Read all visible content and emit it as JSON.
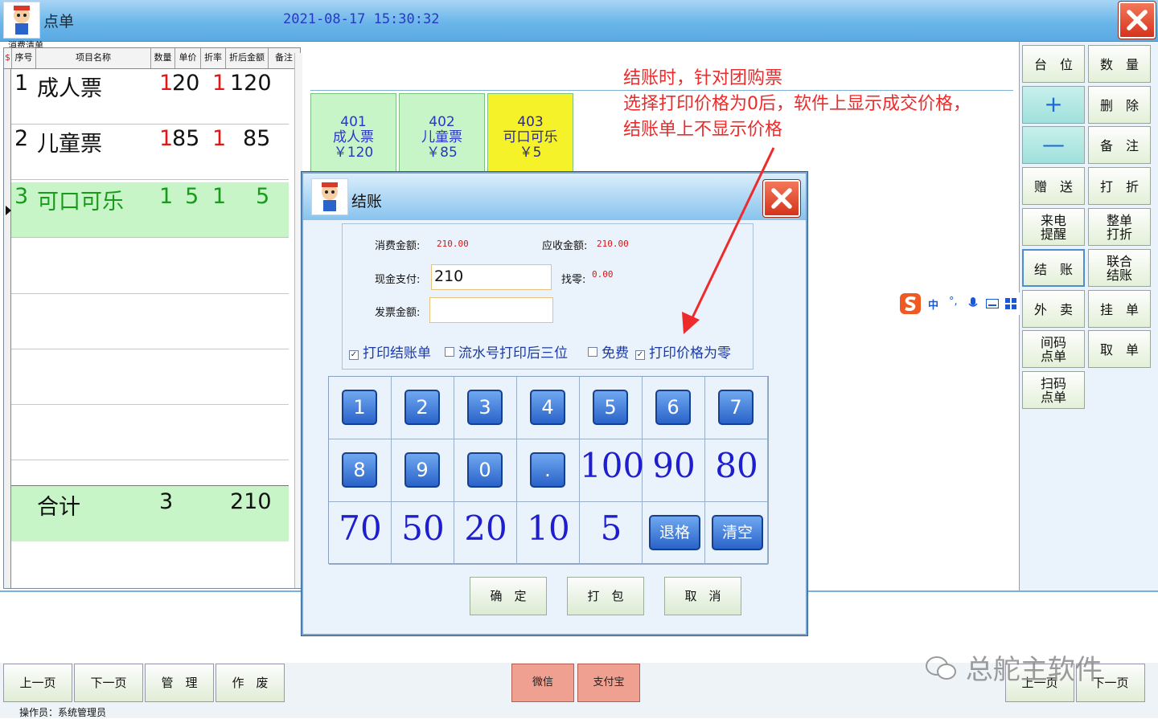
{
  "window": {
    "title": "点单",
    "datetime": "2021-08-17  15:30:32"
  },
  "order": {
    "caption": "消费清单",
    "columns": [
      "序号",
      "项目名称",
      "数量",
      "单价",
      "折率",
      "折后金额",
      "备注"
    ],
    "rows": [
      {
        "no": "1",
        "name": "成人票",
        "qty": "1",
        "price": "20",
        "rate": "1",
        "amount": "120"
      },
      {
        "no": "2",
        "name": "儿童票",
        "qty": "1",
        "price": "85",
        "rate": "1",
        "amount": "85"
      },
      {
        "no": "3",
        "name": "可口可乐",
        "qty": "1",
        "price": "5",
        "rate": "1",
        "amount": "5"
      }
    ],
    "total": {
      "label": "合计",
      "qty": "3",
      "amount": "210"
    }
  },
  "products": [
    {
      "code": "401",
      "name": "成人票",
      "price": "￥120"
    },
    {
      "code": "402",
      "name": "儿童票",
      "price": "￥85"
    },
    {
      "code": "403",
      "name": "可口可乐",
      "price": "￥5"
    }
  ],
  "annotation": [
    "结账时，针对团购票",
    "选择打印价格为0后，软件上显示成交价格，",
    "结账单上不显示价格"
  ],
  "right_buttons": [
    {
      "line1": "台　位",
      "line2": ""
    },
    {
      "line1": "数　量",
      "line2": ""
    },
    {
      "line1": "+",
      "line2": ""
    },
    {
      "line1": "删　除",
      "line2": ""
    },
    {
      "line1": "—",
      "line2": ""
    },
    {
      "line1": "备　注",
      "line2": ""
    },
    {
      "line1": "赠　送",
      "line2": ""
    },
    {
      "line1": "打　折",
      "line2": ""
    },
    {
      "line1": "来电",
      "line2": "提醒"
    },
    {
      "line1": "整单",
      "line2": "打折"
    },
    {
      "line1": "结　账",
      "line2": ""
    },
    {
      "line1": "联合",
      "line2": "结账"
    },
    {
      "line1": "外　卖",
      "line2": ""
    },
    {
      "line1": "挂　单",
      "line2": ""
    },
    {
      "line1": "间码",
      "line2": "点单"
    },
    {
      "line1": "取　单",
      "line2": ""
    },
    {
      "line1": "扫码",
      "line2": "点单"
    }
  ],
  "ime": {
    "label": "中"
  },
  "footer": {
    "prev": "上一页",
    "next": "下一页",
    "manage": "管　理",
    "void": "作　废",
    "wechat": "微信",
    "alipay": "支付宝",
    "prev2": "上一页",
    "next2": "下一页",
    "operator": "操作员：系统管理员"
  },
  "watermark": "总舵主软件",
  "dialog": {
    "title": "结账",
    "consume_label": "消费金额:",
    "consume_value": "210.00",
    "receivable_label": "应收金额:",
    "receivable_value": "210.00",
    "cash_label": "现金支付:",
    "cash_value": "210",
    "change_label": "找零:",
    "change_value": "0.00",
    "invoice_label": "发票金额:",
    "invoice_value": "",
    "options": [
      {
        "label": "打印结账单",
        "checked": true
      },
      {
        "label": "流水号打印后三位",
        "checked": false
      },
      {
        "label": "免费",
        "checked": false
      },
      {
        "label": "打印价格为零",
        "checked": true
      }
    ],
    "keys_row1": [
      "1",
      "2",
      "3",
      "4",
      "5",
      "6",
      "7"
    ],
    "keys_row2": [
      "8",
      "9",
      "0",
      ".",
      "100",
      "90",
      "80"
    ],
    "keys_row3": [
      "70",
      "50",
      "20",
      "10",
      "5",
      "退格",
      "清空"
    ],
    "confirm": "确　定",
    "pack": "打　包",
    "cancel": "取　消"
  }
}
